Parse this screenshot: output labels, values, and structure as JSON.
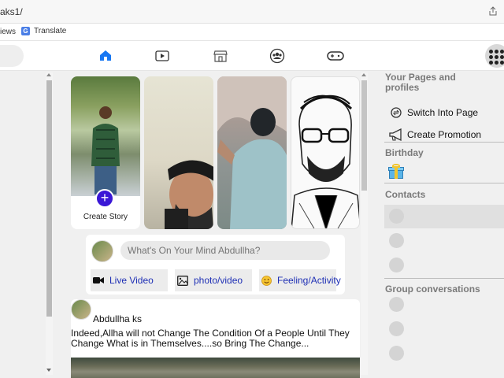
{
  "browser": {
    "url_fragment": "aks1/",
    "bookmarks": [
      "iews",
      "Translate"
    ]
  },
  "stories": {
    "create_label": "Create Story",
    "plus_symbol": "+"
  },
  "composer": {
    "placeholder": "What's On Your Mind Abdullha?",
    "buttons": {
      "live_video": "Live Video",
      "photo_video": "photo/video",
      "feeling": "Feeling/Activity"
    }
  },
  "post": {
    "author": "Abdullha ks",
    "text_line1": "Indeed,Allha will not Change The Condition Of a People Until They",
    "text_line2": "Change What is in Themselves....so Bring The Change..."
  },
  "sidebar": {
    "pages_heading": "Your Pages and profiles",
    "switch_page": "Switch Into Page",
    "create_promotion": "Create Promotion",
    "birthday_heading": "Birthday",
    "contacts_heading": "Contacts",
    "groups_heading": "Group conversations"
  },
  "colors": {
    "accent": "#1e2fb5",
    "story_plus": "#3a17d6",
    "home_icon": "#1877f2"
  },
  "icons": {
    "nav": [
      "home-icon",
      "video-icon",
      "marketplace-icon",
      "groups-icon",
      "gaming-icon"
    ],
    "menu": "grid-menu-icon"
  }
}
